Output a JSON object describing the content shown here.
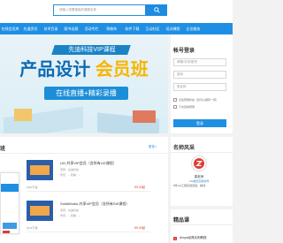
{
  "search": {
    "placeholder": "请输入您要搜索的课程名称"
  },
  "nav": {
    "items": [
      "在线会员库",
      "先道资讯",
      "技术目录",
      "图书出版",
      "活动专栏",
      "购物车",
      "软件下载",
      "互动社区",
      "培训课程",
      "企业服务"
    ]
  },
  "banner": {
    "tag": "先迪科技VIP课程",
    "title_left": "产品设计",
    "title_right": "会员班",
    "subtitle": "在线直播+精彩录播"
  },
  "login": {
    "title": "帐号登录",
    "username_placeholder": "邮箱/手机/账号",
    "password_placeholder": "密码",
    "code_placeholder": "验证码",
    "button": "登录",
    "remember": "记住登录状态（您可以保存一周）",
    "agree": "下次自动登录"
  },
  "courses": {
    "title": "班",
    "more": "更多>",
    "items": [
      {
        "title": "UG-共享VIP会员（含所有UG课程）",
        "teacher": "老师：先迪科技",
        "students": "学员：-- 观看：--",
        "count": "共80节课",
        "price": "¥9.00起"
      },
      {
        "title": "SolidWorks-共享VIP会员（含所有SW课程）",
        "teacher": "老师：先迪科技",
        "students": "学员：-- 观看：--",
        "count": "共34节课",
        "price": "¥9.00起"
      }
    ]
  },
  "famous": {
    "title": "名师风采",
    "name": "梁老师",
    "role": "UG数控高级讲师",
    "desc": "8年UG工程实践经验，精通..."
  },
  "featured": {
    "title": "精品课",
    "items": [
      {
        "num": "1",
        "label": "Ansys经典实例教程"
      }
    ]
  }
}
